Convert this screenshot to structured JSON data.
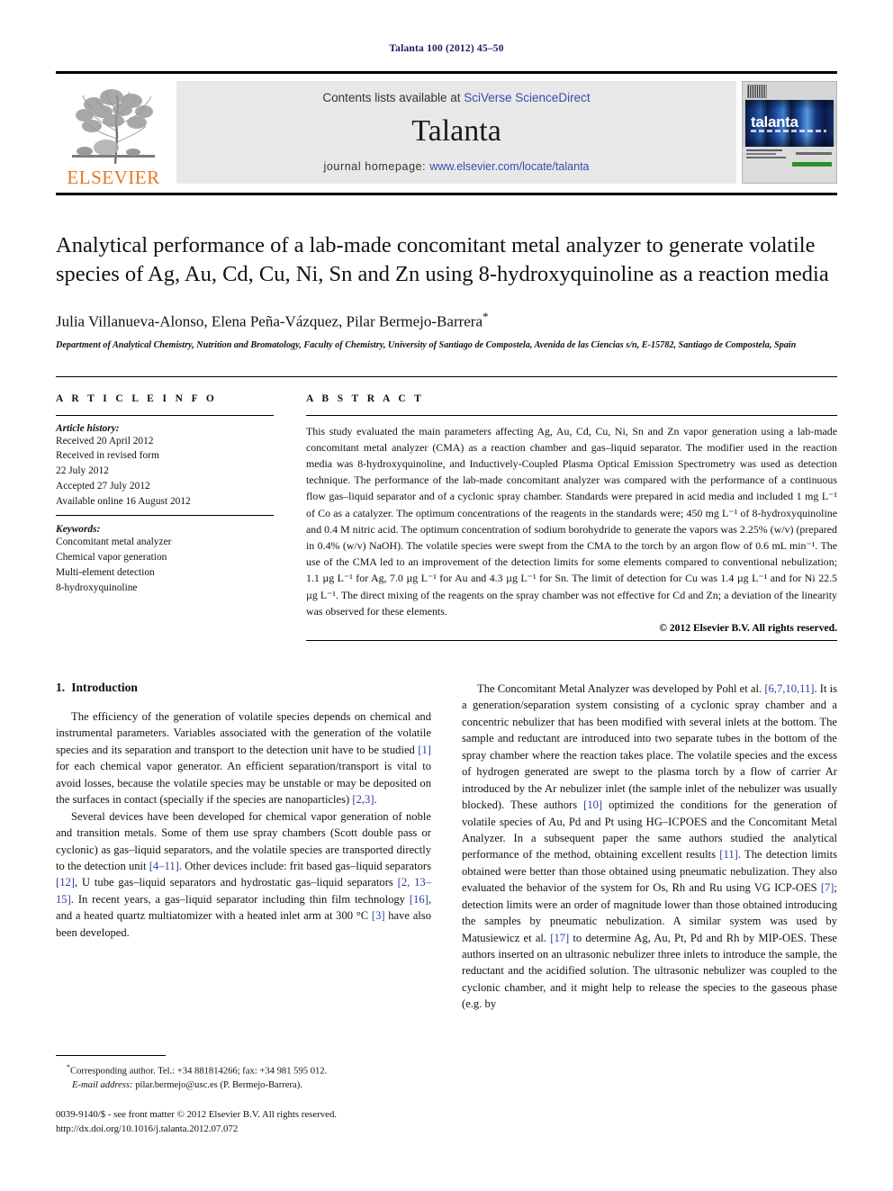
{
  "running_head": "Talanta 100 (2012) 45–50",
  "masthead": {
    "contents_prefix": "Contents lists available at ",
    "contents_link": "SciVerse ScienceDirect",
    "journal_name": "Talanta",
    "homepage_prefix": "journal homepage: ",
    "homepage_link": "www.elsevier.com/locate/talanta",
    "publisher_wordmark": "ELSEVIER",
    "cover_title": "talanta"
  },
  "article": {
    "title": "Analytical performance of a lab-made concomitant metal analyzer to generate volatile species of Ag, Au, Cd, Cu, Ni, Sn and Zn using 8-hydroxyquinoline as a reaction media",
    "authors": "Julia Villanueva-Alonso, Elena Peña-Vázquez, Pilar Bermejo-Barrera",
    "affiliation": "Department of Analytical Chemistry, Nutrition and Bromatology, Faculty of Chemistry, University of Santiago de Compostela, Avenida de las Ciencias s/n, E-15782, Santiago de Compostela, Spain"
  },
  "article_info": {
    "heading": "A R T I C L E   I N F O",
    "history_label": "Article history:",
    "history": [
      "Received 20 April 2012",
      "Received in revised form",
      "22 July 2012",
      "Accepted 27 July 2012",
      "Available online 16 August 2012"
    ],
    "keywords_label": "Keywords:",
    "keywords": [
      "Concomitant metal analyzer",
      "Chemical vapor generation",
      "Multi-element detection",
      "8-hydroxyquinoline"
    ]
  },
  "abstract": {
    "heading": "A B S T R A C T",
    "text": "This study evaluated the main parameters affecting Ag, Au, Cd, Cu, Ni, Sn and Zn vapor generation using a lab-made concomitant metal analyzer (CMA) as a reaction chamber and gas–liquid separator. The modifier used in the reaction media was 8-hydroxyquinoline, and Inductively-Coupled Plasma Optical Emission Spectrometry was used as detection technique. The performance of the lab-made concomitant analyzer was compared with the performance of a continuous flow gas–liquid separator and of a cyclonic spray chamber. Standards were prepared in acid media and included 1 mg L⁻¹ of Co as a catalyzer. The optimum concentrations of the reagents in the standards were; 450 mg L⁻¹ of 8-hydroxyquinoline and 0.4 M nitric acid. The optimum concentration of sodium borohydride to generate the vapors was 2.25% (w/v) (prepared in 0.4% (w/v) NaOH). The volatile species were swept from the CMA to the torch by an argon flow of 0.6 mL min⁻¹. The use of the CMA led to an improvement of the detection limits for some elements compared to conventional nebulization; 1.1 µg L⁻¹ for Ag, 7.0 µg L⁻¹ for Au and 4.3 µg L⁻¹ for Sn. The limit of detection for Cu was 1.4 µg L⁻¹ and for Ni 22.5 µg L⁻¹. The direct mixing of the reagents on the spray chamber was not effective for Cd and Zn; a deviation of the linearity was observed for these elements.",
    "copyright": "© 2012 Elsevier B.V. All rights reserved."
  },
  "introduction": {
    "number": "1.",
    "title": "Introduction",
    "left_paragraphs": [
      "The efficiency of the generation of volatile species depends on chemical and instrumental parameters. Variables associated with the generation of the volatile species and its separation and transport to the detection unit have to be studied [1] for each chemical vapor generator. An efficient separation/transport is vital to avoid losses, because the volatile species may be unstable or may be deposited on the surfaces in contact (specially if the species are nanoparticles) [2,3].",
      "Several devices have been developed for chemical vapor generation of noble and transition metals. Some of them use spray chambers (Scott double pass or cyclonic) as gas–liquid separators, and the volatile species are transported directly to the detection unit [4–11]. Other devices include: frit based gas–liquid separators [12], U tube gas–liquid separators and hydrostatic gas–liquid separators [2, 13–15]. In recent years, a gas–liquid separator including thin film technology [16], and a heated quartz multiatomizer with a heated inlet arm at 300 °C [3] have also been developed."
    ],
    "right_paragraphs": [
      "The Concomitant Metal Analyzer was developed by Pohl et al. [6,7,10,11]. It is a generation/separation system consisting of a cyclonic spray chamber and a concentric nebulizer that has been modified with several inlets at the bottom. The sample and reductant are introduced into two separate tubes in the bottom of the spray chamber where the reaction takes place. The volatile species and the excess of hydrogen generated are swept to the plasma torch by a flow of carrier Ar introduced by the Ar nebulizer inlet (the sample inlet of the nebulizer was usually blocked). These authors [10] optimized the conditions for the generation of volatile species of Au, Pd and Pt using HG–ICPOES and the Concomitant Metal Analyzer. In a subsequent paper the same authors studied the analytical performance of the method, obtaining excellent results [11]. The detection limits obtained were better than those obtained using pneumatic nebulization. They also evaluated the behavior of the system for Os, Rh and Ru using VG ICP-OES [7]; detection limits were an order of magnitude lower than those obtained introducing the samples by pneumatic nebulization. A similar system was used by Matusiewicz et al. [17] to determine Ag, Au, Pt, Pd and Rh by MIP-OES. These authors inserted on an ultrasonic nebulizer three inlets to introduce the sample, the reductant and the acidified solution. The ultrasonic nebulizer was coupled to the cyclonic chamber, and it might help to release the species to the gaseous phase (e.g. by"
    ]
  },
  "footnotes": {
    "corresponding": "Corresponding author. Tel.: +34 881814266; fax: +34 981 595 012.",
    "email_label": "E-mail address:",
    "email": "pilar.bermejo@usc.es (P. Bermejo-Barrera).",
    "issn_line": "0039-9140/$ - see front matter © 2012 Elsevier B.V. All rights reserved.",
    "doi_line": "http://dx.doi.org/10.1016/j.talanta.2012.07.072"
  },
  "colors": {
    "link": "#3b4ba8",
    "citation": "#2b3f9e",
    "elsevier_orange": "#E87722",
    "running_head": "#1a1a5e"
  }
}
